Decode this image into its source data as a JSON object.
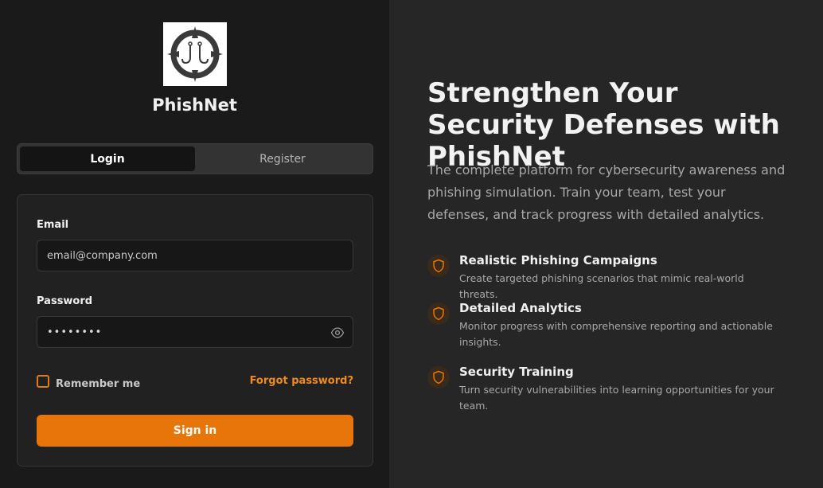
{
  "brand": {
    "name": "PhishNet",
    "logo_icon": "compass-fishhook-logo"
  },
  "tabs": [
    {
      "label": "Login",
      "active": true
    },
    {
      "label": "Register",
      "active": false
    }
  ],
  "form": {
    "email_label": "Email",
    "email_placeholder": "email@company.com",
    "password_label": "Password",
    "password_value": "••••••••",
    "remember_label": "Remember me",
    "forgot_label": "Forgot password?",
    "signin_label": "Sign in"
  },
  "hero": {
    "headline": "Strengthen Your Security Defenses with PhishNet",
    "subtext": "The complete platform for cybersecurity awareness and phishing simulation. Train your team, test your defenses, and track progress with detailed analytics."
  },
  "features": [
    {
      "title": "Realistic Phishing Campaigns",
      "description": "Create targeted phishing scenarios that mimic real-world threats.",
      "icon": "shield-icon"
    },
    {
      "title": "Detailed Analytics",
      "description": "Monitor progress with comprehensive reporting and actionable insights.",
      "icon": "shield-icon"
    },
    {
      "title": "Security Training",
      "description": "Turn security vulnerabilities into learning opportunities for your team.",
      "icon": "shield-icon"
    }
  ],
  "colors": {
    "accent": "#e8750a",
    "link": "#f08a20",
    "left_bg": "#1a1a1a",
    "right_bg": "#262626"
  }
}
